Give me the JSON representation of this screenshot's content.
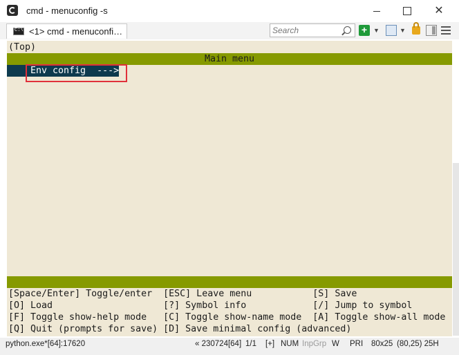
{
  "window": {
    "title": "cmd - menuconfig  -s",
    "icon": "conemu-icon"
  },
  "tab": {
    "label": "<1> cmd - menuconfi…",
    "icon": "console-icon"
  },
  "search": {
    "placeholder": "Search"
  },
  "console": {
    "top_indicator": "(Top)",
    "menu_title": "Main menu",
    "selected_item": "Env config  --->",
    "help_lines": [
      "[Space/Enter] Toggle/enter  [ESC] Leave menu           [S] Save",
      "[O] Load                    [?] Symbol info            [/] Jump to symbol",
      "[F] Toggle show-help mode   [C] Toggle show-name mode  [A] Toggle show-all mode",
      "[Q] Quit (prompts for save) [D] Save minimal config (advanced)"
    ]
  },
  "statusbar": {
    "process": "python.exe*[64]:17620",
    "build": "« 230724[64]",
    "console_index": "1/1",
    "plus": "[+]",
    "num": "NUM",
    "inpgrp": "InpGrp",
    "w": "W",
    "pri": "PRI",
    "size": "80x25",
    "cursor": "(80,25) 25H"
  },
  "colors": {
    "console_bg": "#efe8d5",
    "menu_bar": "#869a00",
    "selection_bg": "#0e3a4e",
    "highlight_box": "#e0303a"
  }
}
